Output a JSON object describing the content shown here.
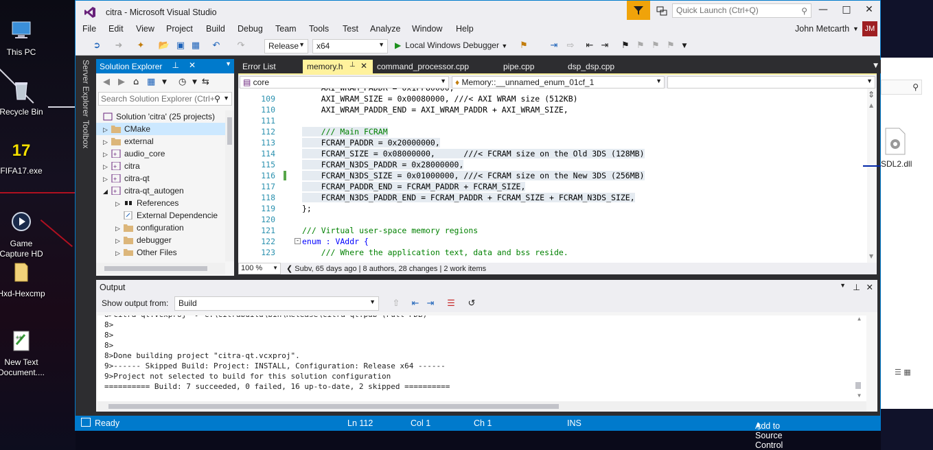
{
  "desktop": {
    "icons": [
      {
        "label": "This PC"
      },
      {
        "label": "Recycle Bin"
      },
      {
        "label": "FIFA17.exe",
        "badge": "17"
      },
      {
        "label": "Game\nCapture HD"
      },
      {
        "label": "Hxd-Hexcmp"
      },
      {
        "label": "New Text\nDocument...."
      }
    ],
    "right_file": "SDL2.dll"
  },
  "window": {
    "title": "citra - Microsoft Visual Studio",
    "quick_launch_placeholder": "Quick Launch (Ctrl+Q)",
    "user_name": "John Metcarth",
    "user_initials": "JM"
  },
  "menu": [
    "File",
    "Edit",
    "View",
    "Project",
    "Build",
    "Debug",
    "Team",
    "Tools",
    "Test",
    "Analyze",
    "Window",
    "Help"
  ],
  "toolbar": {
    "configuration": "Release",
    "platform": "x64",
    "debugger": "Local Windows Debugger"
  },
  "sidebar_tabs": [
    "Server Explorer",
    "Toolbox"
  ],
  "solution_explorer": {
    "title": "Solution Explorer",
    "search_placeholder": "Search Solution Explorer (Ctrl+",
    "nodes": [
      {
        "label": "Solution 'citra' (25 projects)"
      },
      {
        "label": "CMake"
      },
      {
        "label": "external"
      },
      {
        "label": "audio_core"
      },
      {
        "label": "citra"
      },
      {
        "label": "citra-qt"
      },
      {
        "label": "citra-qt_autogen"
      },
      {
        "label": "References"
      },
      {
        "label": "External Dependencie"
      },
      {
        "label": "configuration"
      },
      {
        "label": "debugger"
      },
      {
        "label": "Other Files"
      }
    ]
  },
  "editor": {
    "tabs": [
      "Error List",
      "memory.h",
      "command_processor.cpp",
      "pipe.cpp",
      "dsp_dsp.cpp"
    ],
    "nav_scope": "core",
    "nav_member": "Memory::__unnamed_enum_01cf_1",
    "zoom": "100 %",
    "git_info": "Subv, 65 days ago | 8 authors, 28 changes | 2 work items",
    "lines": [
      {
        "n": "109",
        "t": "    AXI_WRAM_SIZE = 0x00080000, ///< AXI WRAM size (512KB)"
      },
      {
        "n": "110",
        "t": "    AXI_WRAM_PADDR_END = AXI_WRAM_PADDR + AXI_WRAM_SIZE,"
      },
      {
        "n": "111",
        "t": ""
      },
      {
        "n": "112",
        "t": "    /// Main FCRAM"
      },
      {
        "n": "113",
        "t": "    FCRAM_PADDR = 0x20000000,"
      },
      {
        "n": "114",
        "t": "    FCRAM_SIZE = 0x08000000,      ///< FCRAM size on the Old 3DS (128MB)"
      },
      {
        "n": "115",
        "t": "    FCRAM_N3DS_PADDR = 0x28000000,"
      },
      {
        "n": "116",
        "t": "    FCRAM_N3DS_SIZE = 0x01000000, ///< FCRAM size on the New 3DS (256MB)"
      },
      {
        "n": "117",
        "t": "    FCRAM_PADDR_END = FCRAM_PADDR + FCRAM_SIZE,"
      },
      {
        "n": "118",
        "t": "    FCRAM_N3DS_PADDR_END = FCRAM_PADDR + FCRAM_SIZE + FCRAM_N3DS_SIZE,"
      },
      {
        "n": "119",
        "t": "};"
      },
      {
        "n": "120",
        "t": ""
      },
      {
        "n": "121",
        "t": "/// Virtual user-space memory regions"
      },
      {
        "n": "122",
        "t": "enum : VAddr {"
      },
      {
        "n": "123",
        "t": "    /// Where the application text, data and bss reside."
      }
    ]
  },
  "output": {
    "title": "Output",
    "show_from_label": "Show output from:",
    "source": "Build",
    "lines": [
      "8>",
      "8>",
      "8>",
      "8>Done building project \"citra-qt.vcxproj\".",
      "9>------ Skipped Build: Project: INSTALL, Configuration: Release x64 ------",
      "9>Project not selected to build for this solution configuration",
      "========== Build: 7 succeeded, 0 failed, 16 up-to-date, 2 skipped =========="
    ]
  },
  "status": {
    "state": "Ready",
    "ln": "Ln 112",
    "col": "Col 1",
    "ch": "Ch 1",
    "mode": "INS",
    "source_control": "Add to Source Control"
  },
  "colors": {
    "accent": "#007acc",
    "active_tab": "#fff29d",
    "avatar": "#9e1f22",
    "filter": "#f0a30a"
  }
}
